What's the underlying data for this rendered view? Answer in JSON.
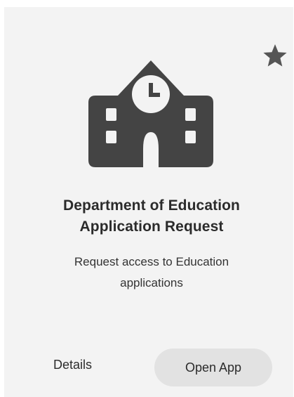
{
  "app": {
    "title_line1": "Department of Education",
    "title_line2": "Application Request",
    "description_line1": "Request access to Education",
    "description_line2": "applications",
    "icon": "school-building-icon"
  },
  "favorite": {
    "icon": "star-icon",
    "color": "#555555"
  },
  "actions": {
    "details_label": "Details",
    "open_label": "Open App"
  },
  "colors": {
    "icon": "#444444",
    "card_background": "#f3f3f3",
    "button_background": "#e2e2e2"
  }
}
